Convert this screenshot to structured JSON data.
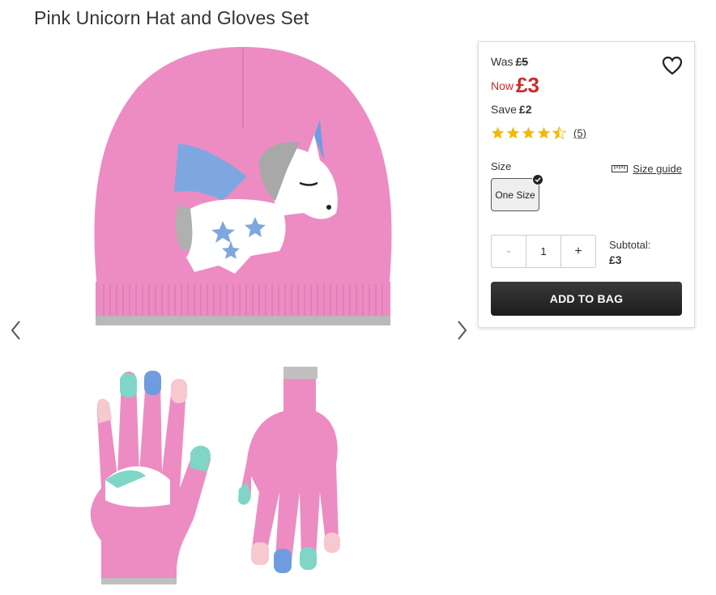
{
  "product": {
    "title": "Pink Unicorn Hat and Gloves Set"
  },
  "gallery": {
    "prev_icon": "chevron-left-icon",
    "next_icon": "chevron-right-icon"
  },
  "pricing": {
    "was_label": "Was",
    "was_price": "£5",
    "now_label": "Now",
    "now_price": "£3",
    "save_label": "Save",
    "save_amount": "£2",
    "now_color": "#d0282a"
  },
  "rating": {
    "value": 4.5,
    "max": 5,
    "count_text": "(5)",
    "star_color": "#f5b800"
  },
  "size": {
    "label": "Size",
    "guide_text": "Size guide",
    "options": [
      "One Size"
    ],
    "selected": "One Size"
  },
  "quantity": {
    "minus": "-",
    "value": "1",
    "plus": "+"
  },
  "subtotal": {
    "label": "Subtotal:",
    "value": "£3"
  },
  "cta": {
    "label": "ADD TO BAG"
  },
  "wishlist": {
    "icon": "heart-icon"
  }
}
